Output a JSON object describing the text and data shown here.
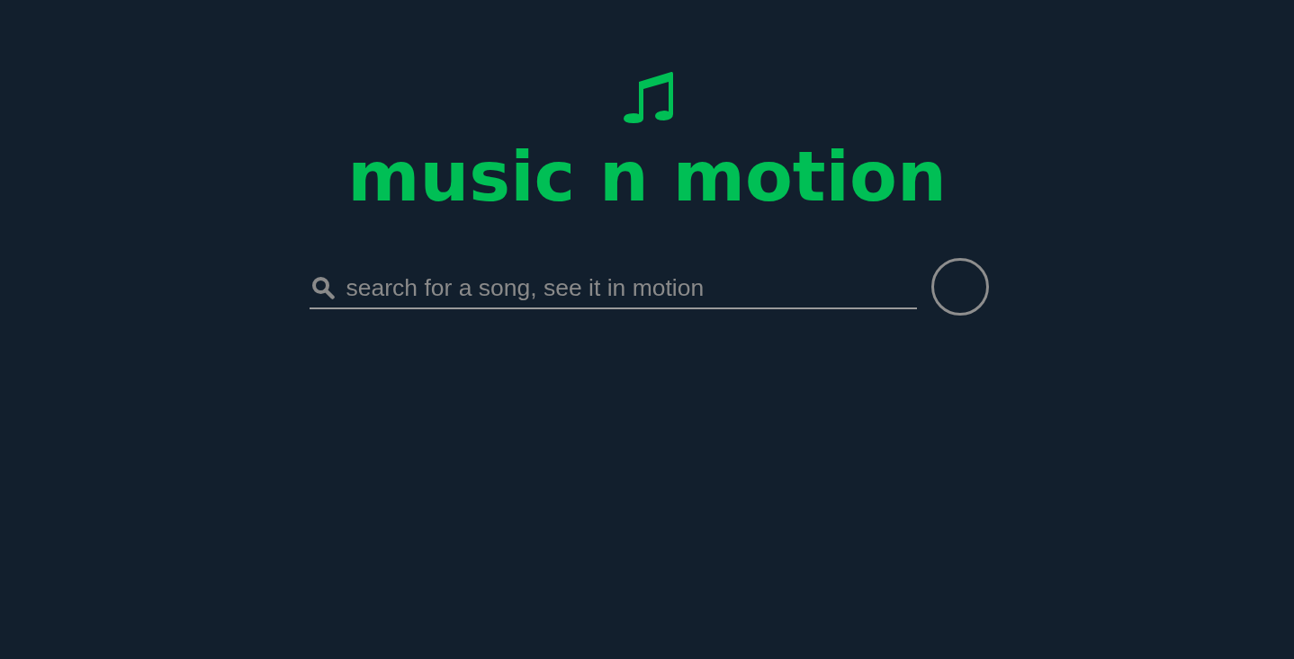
{
  "logo": {
    "title": "music n motion"
  },
  "search": {
    "placeholder": "search for a song, see it in motion"
  }
}
